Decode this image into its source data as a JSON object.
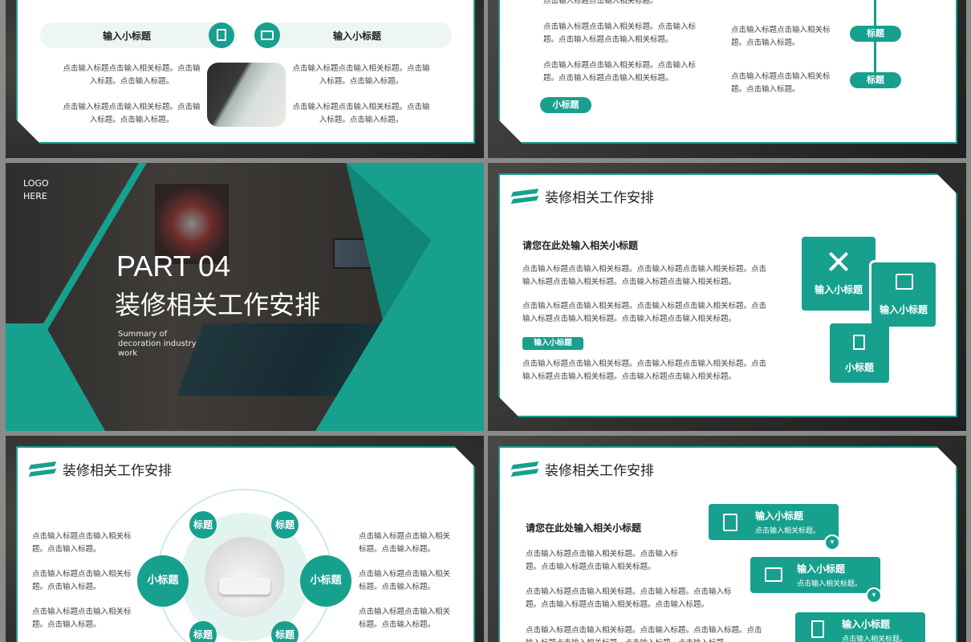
{
  "slide1": {
    "left_pill": "输入小标题",
    "right_pill": "输入小标题",
    "texts_left": [
      "点击输入标题点击输入相关标题。点击输入标题。点击输入标题。",
      "点击输入标题点击输入相关标题。点击输入标题。点击输入标题。"
    ],
    "texts_right": [
      "点击输入标题点击输入相关标题。点击输入标题。点击输入标题。",
      "点击输入标题点击输入相关标题。点击输入标题。点击输入标题。"
    ]
  },
  "slide2": {
    "top_text": "点击输入标题点击输入相关标题。",
    "texts": [
      "点击输入标题点击输入相关标题。点击输入标题。点击输入标题点击输入相关标题。",
      "点击输入标题点击输入相关标题。点击输入标题。点击输入标题点击输入相关标题。"
    ],
    "sub_pill": "小标题",
    "right_texts": [
      "点击输入标题点击输入相关标题。点击输入标题。",
      "点击输入标题点击输入相关标题。点击输入标题。"
    ],
    "timeline_labels": [
      "标题",
      "标题"
    ]
  },
  "slide3": {
    "logo": "LOGO\nHERE",
    "part": "PART 04",
    "title": "装修相关工作安排",
    "summary": "Summary of\ndecoration industry\nwork"
  },
  "slide4": {
    "title": "装修相关工作安排",
    "subtitle": "请您在此处输入相关小标题",
    "para1": "点击输入标题点击输入相关标题。点击输入标题点击输入相关标题。点击输入标题点击输入相关标题。点击输入标题点击输入相关标题。",
    "para2": "点击输入标题点击输入相关标题。点击输入标题点击输入相关标题。点击输入标题点击输入相关标题。点击输入标题点击输入相关标题。",
    "pill": "输入小标题",
    "para3": "点击输入标题点击输入相关标题。点击输入标题点击输入相关标题。点击输入标题点击输入相关标题。点击输入标题点击输入相关标题。",
    "box1": "输入小标题",
    "box2": "输入小标题",
    "box3": "小标题"
  },
  "slide5": {
    "title": "装修相关工作安排",
    "left_texts": [
      "点击输入标题点击输入相关标题。点击输入标题。",
      "点击输入标题点击输入相关标题。点击输入标题。",
      "点击输入标题点击输入相关标题。点击输入标题。"
    ],
    "right_texts": [
      "点击输入标题点击输入相关标题。点击输入标题。",
      "点击输入标题点击输入相关标题。点击输入标题。",
      "点击输入标题点击输入相关标题。点击输入标题。"
    ],
    "small_circles": [
      "标题",
      "标题",
      "标题",
      "标题"
    ],
    "big_circles": [
      "小标题",
      "小标题"
    ]
  },
  "slide6": {
    "title": "装修相关工作安排",
    "subtitle": "请您在此处输入相关小标题",
    "para1": "点击输入标题点击输入相关标题。点击输入标题。点击输入标题点击输入相关标题。",
    "para2": "点击输入标题点击输入相关标题。点击输入标题。点击输入标题。点击输入标题点击输入相关标题。点击输入标题。",
    "para3": "点击输入标题点击输入相关标题。点击输入标题。点击输入标题。点击输入标题点击输入相关标题。点击输入标题。点击输入标题。",
    "steps": [
      {
        "title": "输入小标题",
        "sub": "点击输入相关标题。"
      },
      {
        "title": "输入小标题",
        "sub": "点击输入相关标题。"
      },
      {
        "title": "输入小标题",
        "sub": "点击输入相关标题。"
      }
    ]
  }
}
